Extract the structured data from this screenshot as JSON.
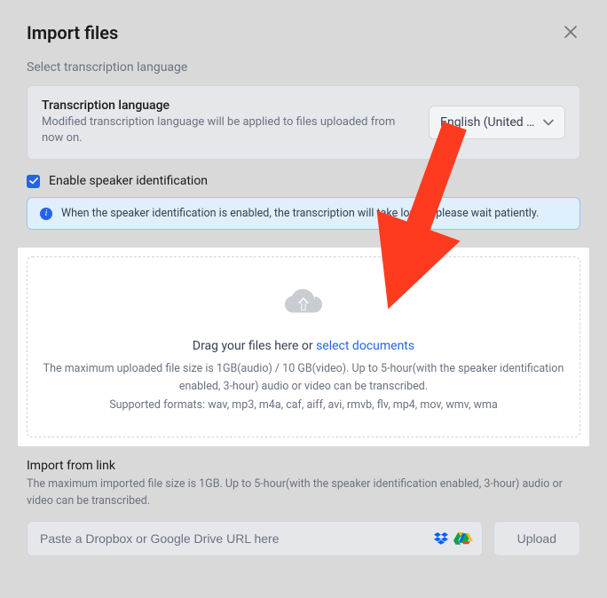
{
  "header": {
    "title": "Import files"
  },
  "language": {
    "section_label": "Select transcription language",
    "box_title": "Transcription language",
    "box_desc": "Modified transcription language will be applied to files uploaded from now on.",
    "selected": "English (United …"
  },
  "speaker": {
    "checkbox_label": "Enable speaker identification",
    "info_text": "When the speaker identification is enabled, the transcription will take longer, please wait patiently."
  },
  "dropzone": {
    "main_prefix": "Drag your files here or ",
    "link_text": "select documents",
    "desc": "The maximum uploaded file size is 1GB(audio) / 10 GB(video). Up to 5-hour(with the speaker identification enabled, 3-hour) audio or video can be transcribed.",
    "formats": "Supported formats: wav, mp3, m4a, caf, aiff, avi, rmvb, flv, mp4, mov, wmv, wma"
  },
  "import_link": {
    "title": "Import from link",
    "desc": "The maximum imported file size is 1GB. Up to 5-hour(with the speaker identification enabled, 3-hour) audio or video can be transcribed.",
    "placeholder": "Paste a Dropbox or Google Drive URL here",
    "upload_label": "Upload"
  }
}
